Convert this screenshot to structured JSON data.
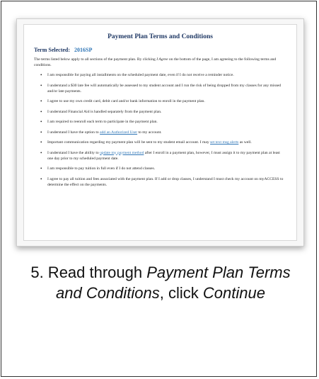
{
  "document": {
    "title": "Payment Plan Terms and Conditions",
    "term_label": "Term Selected:",
    "term_value": "2016SP",
    "intro_before": "The terms listed below apply to all sections of the payment plan. By clicking ",
    "intro_emphasis": "I Agree",
    "intro_after": " on the bottom of the page, I am agreeing to the following terms and conditions.",
    "terms": [
      {
        "text": "I am responsible for paying all installments on the scheduled payment date, even if I do not receive a reminder notice."
      },
      {
        "text": "I understand a $30 late fee will automatically be assessed to my student account and I run the risk of being dropped from my classes for any missed and/or late payments."
      },
      {
        "text": "I agree to use my own credit card, debit card and/or bank information to enroll in the payment plan."
      },
      {
        "text": "I understand Financial Aid is handled separately from the payment plan."
      },
      {
        "text": "I am required to reenroll each term to participate in the payment plan."
      },
      {
        "before": "I understand I have the option to ",
        "link": "add an Authorized User",
        "after": " to my account."
      },
      {
        "before": "Important communication regarding my payment plan will be sent to my student email account. I may ",
        "link": "set text msg alerts",
        "after": " as well."
      },
      {
        "before": "I understand I have the ability to ",
        "link": "update my payment method",
        "after": " after I enroll in a payment plan, however, I must assign it to my payment plan at least one day prior to my scheduled payment date."
      },
      {
        "text": "I am responsible to pay tuition in full even if I do not attend classes."
      },
      {
        "text": "I agree to pay all tuition and fees associated with the payment plan. If I add or drop classes, I understand I must check my account on myACCESS to determine the effect on the payments."
      }
    ]
  },
  "caption": {
    "prefix": "5. Read through ",
    "emphasis1": "Payment Plan Terms and Conditions",
    "middle": ", click ",
    "emphasis2": "Continue"
  }
}
